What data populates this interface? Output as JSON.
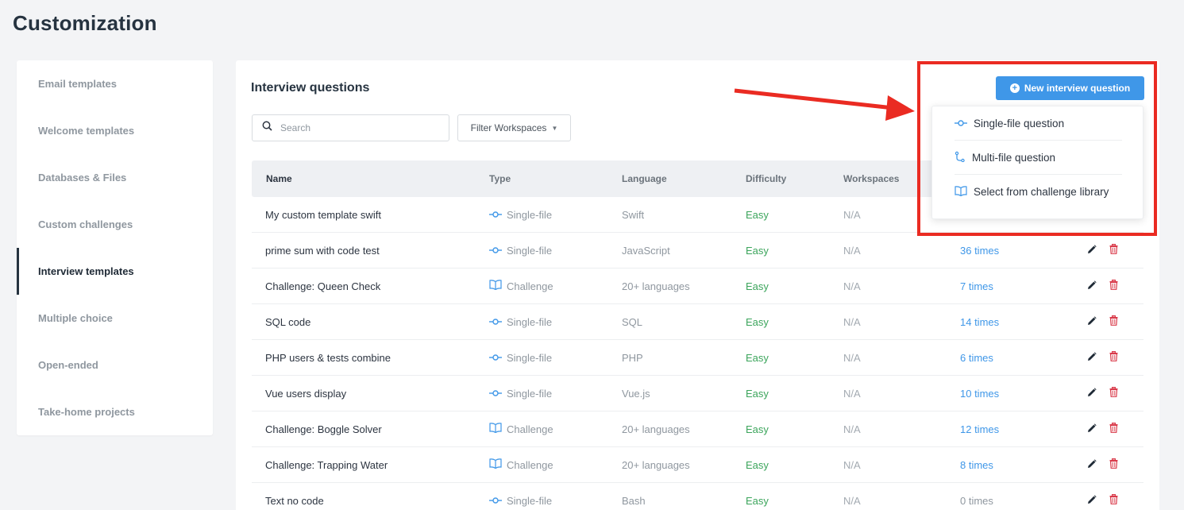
{
  "page": {
    "title": "Customization"
  },
  "sidebar": {
    "items": [
      {
        "label": "Email templates"
      },
      {
        "label": "Welcome templates"
      },
      {
        "label": "Databases & Files"
      },
      {
        "label": "Custom challenges"
      },
      {
        "label": "Interview templates",
        "active": true
      },
      {
        "label": "Multiple choice"
      },
      {
        "label": "Open-ended"
      },
      {
        "label": "Take-home projects"
      }
    ]
  },
  "main": {
    "title": "Interview questions",
    "search": {
      "placeholder": "Search",
      "value": ""
    },
    "filter_label": "Filter Workspaces",
    "new_button_label": "New interview question",
    "table": {
      "columns": [
        "Name",
        "Type",
        "Language",
        "Difficulty",
        "Workspaces"
      ],
      "rows": [
        {
          "name": "My custom template swift",
          "type": "Single-file",
          "type_icon": "single-file-icon",
          "language": "Swift",
          "difficulty": "Easy",
          "workspaces": "N/A",
          "used": ""
        },
        {
          "name": "prime sum with code test",
          "type": "Single-file",
          "type_icon": "single-file-icon",
          "language": "JavaScript",
          "difficulty": "Easy",
          "workspaces": "N/A",
          "used": "36 times"
        },
        {
          "name": "Challenge: Queen Check",
          "type": "Challenge",
          "type_icon": "book-icon",
          "language": "20+ languages",
          "difficulty": "Easy",
          "workspaces": "N/A",
          "used": "7 times"
        },
        {
          "name": "SQL code",
          "type": "Single-file",
          "type_icon": "single-file-icon",
          "language": "SQL",
          "difficulty": "Easy",
          "workspaces": "N/A",
          "used": "14 times"
        },
        {
          "name": "PHP users & tests combine",
          "type": "Single-file",
          "type_icon": "single-file-icon",
          "language": "PHP",
          "difficulty": "Easy",
          "workspaces": "N/A",
          "used": "6 times"
        },
        {
          "name": "Vue users display",
          "type": "Single-file",
          "type_icon": "single-file-icon",
          "language": "Vue.js",
          "difficulty": "Easy",
          "workspaces": "N/A",
          "used": "10 times"
        },
        {
          "name": "Challenge: Boggle Solver",
          "type": "Challenge",
          "type_icon": "book-icon",
          "language": "20+ languages",
          "difficulty": "Easy",
          "workspaces": "N/A",
          "used": "12 times"
        },
        {
          "name": "Challenge: Trapping Water",
          "type": "Challenge",
          "type_icon": "book-icon",
          "language": "20+ languages",
          "difficulty": "Easy",
          "workspaces": "N/A",
          "used": "8 times"
        },
        {
          "name": "Text no code",
          "type": "Single-file",
          "type_icon": "single-file-icon",
          "language": "Bash",
          "difficulty": "Easy",
          "workspaces": "N/A",
          "used": "0 times"
        }
      ]
    },
    "dropdown": {
      "items": [
        {
          "label": "Single-file question",
          "icon": "single-file-icon"
        },
        {
          "label": "Multi-file question",
          "icon": "multi-file-icon"
        },
        {
          "label": "Select from challenge library",
          "icon": "book-icon"
        }
      ]
    }
  },
  "colors": {
    "accent": "#3f97e8",
    "easy": "#3ca55c",
    "delete": "#d93a4a",
    "annotation": "#ea2b22"
  }
}
